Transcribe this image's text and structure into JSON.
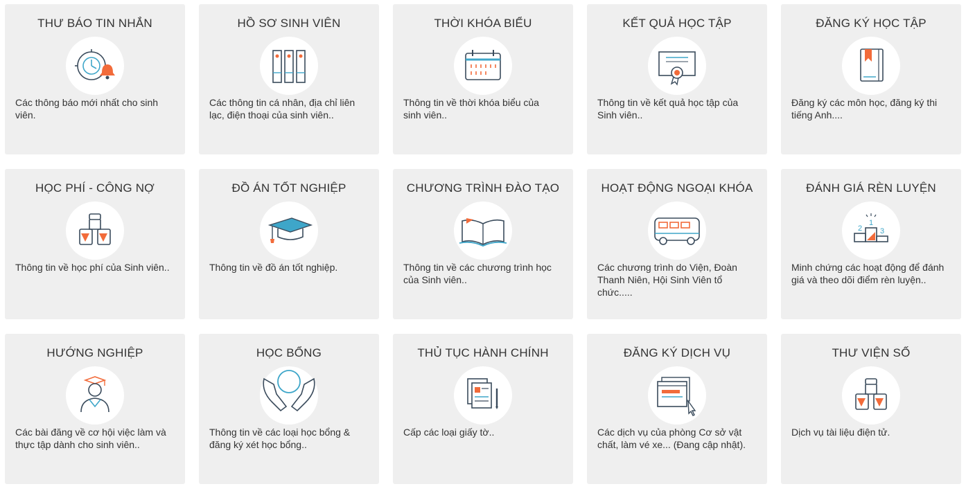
{
  "colors": {
    "card_bg": "#efefef",
    "icon_stroke": "#3a4b5c",
    "accent_orange": "#f26b3a",
    "accent_blue": "#3ea6c9"
  },
  "cards": [
    {
      "title": "THƯ BÁO TIN NHẮN",
      "icon": "clock-bell-icon",
      "desc": "Các thông báo mới nhất cho sinh viên."
    },
    {
      "title": "HỒ SƠ SINH VIÊN",
      "icon": "binders-icon",
      "desc": "Các thông tin cá nhân, địa chỉ liên lạc, điện thoại của sinh viên.."
    },
    {
      "title": "THỜI KHÓA BIỂU",
      "icon": "calendar-icon",
      "desc": "Thông tin về thời khóa biểu của sinh viên.."
    },
    {
      "title": "KẾT QUẢ HỌC TẬP",
      "icon": "certificate-icon",
      "desc": "Thông tin về kết quả học tập của Sinh viên.."
    },
    {
      "title": "ĐĂNG KÝ HỌC TẬP",
      "icon": "bookmark-book-icon",
      "desc": "Đăng ký các môn học, đăng ký thi tiếng Anh...."
    },
    {
      "title": "HỌC PHÍ - CÔNG NỢ",
      "icon": "jars-icon",
      "desc": "Thông tin về học phí của Sinh viên.."
    },
    {
      "title": "ĐỒ ÁN TỐT NGHIỆP",
      "icon": "graduation-cap-icon",
      "desc": "Thông tin về đồ án tốt nghiệp."
    },
    {
      "title": "CHƯƠNG TRÌNH ĐÀO TẠO",
      "icon": "open-book-icon",
      "desc": "Thông tin về các chương trình học của Sinh viên.."
    },
    {
      "title": "HOẠT ĐỘNG NGOẠI KHÓA",
      "icon": "bus-icon",
      "desc": "Các chương trình do Viện, Đoàn Thanh Niên, Hội Sinh Viên tổ chức....."
    },
    {
      "title": "ĐÁNH GIÁ RÈN LUYỆN",
      "icon": "podium-icon",
      "desc": "Minh chứng các hoạt động để đánh giá và theo dõi điểm rèn luyện.."
    },
    {
      "title": "HƯỚNG NGHIỆP",
      "icon": "graduate-person-icon",
      "desc": "Các bài đăng về cơ hội việc làm và thực tập dành cho sinh viên.."
    },
    {
      "title": "HỌC BỔNG",
      "icon": "hands-icon",
      "desc": "Thông tin về các loại học bổng & đăng ký xét học bổng.."
    },
    {
      "title": "THỦ TỤC HÀNH CHÍNH",
      "icon": "documents-pen-icon",
      "desc": "Cấp các loại giấy tờ.."
    },
    {
      "title": "ĐĂNG KÝ DỊCH VỤ",
      "icon": "browser-cursor-icon",
      "desc": "Các dịch vụ của phòng Cơ sở vật chất, làm vé xe... (Đang cập nhật)."
    },
    {
      "title": "THƯ VIỆN SỐ",
      "icon": "jars-icon",
      "desc": "Dịch vụ tài liệu điện tử."
    }
  ]
}
